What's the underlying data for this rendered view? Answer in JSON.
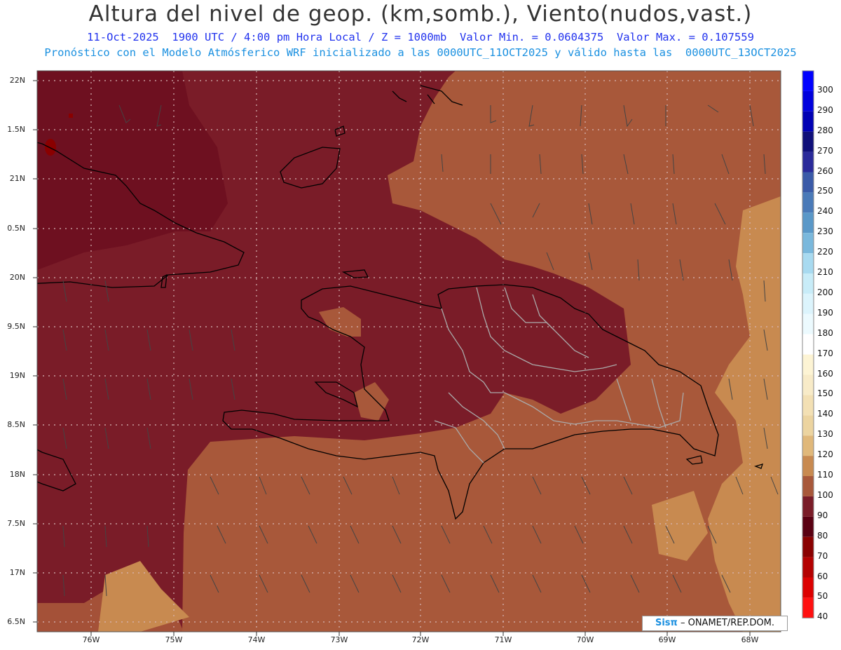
{
  "header": {
    "title": "Altura del nivel de geop. (km,somb.), Viento(nudos,vast.)",
    "subtitle1": "11-Oct-2025  1900 UTC / 4:00 pm Hora Local / Z = 1000mb  Valor Min. = 0.0604375  Valor Max. = 0.107559",
    "subtitle2": "Pronóstico con el Modelo Atmósferico WRF inicializado a las 0000UTC_11OCT2025 y válido hasta las  0000UTC_13OCT2025"
  },
  "axes": {
    "y_labels": [
      "22N",
      "1.5N",
      "21N",
      "0.5N",
      "20N",
      "9.5N",
      "19N",
      "8.5N",
      "18N",
      "7.5N",
      "17N",
      "6.5N"
    ],
    "x_labels": [
      "76W",
      "75W",
      "74W",
      "73W",
      "72W",
      "71W",
      "70W",
      "69W",
      "68W"
    ]
  },
  "colorbar": {
    "labels": [
      "300",
      "290",
      "280",
      "270",
      "260",
      "250",
      "240",
      "230",
      "220",
      "210",
      "200",
      "190",
      "180",
      "170",
      "160",
      "150",
      "140",
      "130",
      "120",
      "110",
      "100",
      "90",
      "80",
      "70",
      "60",
      "50",
      "40"
    ],
    "colors": [
      "#0000ff",
      "#0000dd",
      "#0000b4",
      "#10107a",
      "#2a2a9a",
      "#3a5aa8",
      "#4a7ab8",
      "#5a98c8",
      "#7ab8dc",
      "#a8daf0",
      "#c8ecf8",
      "#dcf4fc",
      "#ecfafe",
      "#ffffff",
      "#fdf4d4",
      "#f8ebc8",
      "#f3e0b4",
      "#ecd4a0",
      "#e0b87a",
      "#c88a50",
      "#a8583a",
      "#7a1c28",
      "#5a0012",
      "#8a0000",
      "#b40000",
      "#dc0000",
      "#ff1010"
    ]
  },
  "credit": {
    "brand": "Sisπ",
    "text": "– ONAMET/REP.DOM."
  },
  "colors": {
    "low": "#7a1c28",
    "mid": "#a8583a",
    "high": "#c88a50",
    "dark_spot": "#8a0000",
    "coast": "#000000",
    "province_border": "#aaaaaa"
  }
}
